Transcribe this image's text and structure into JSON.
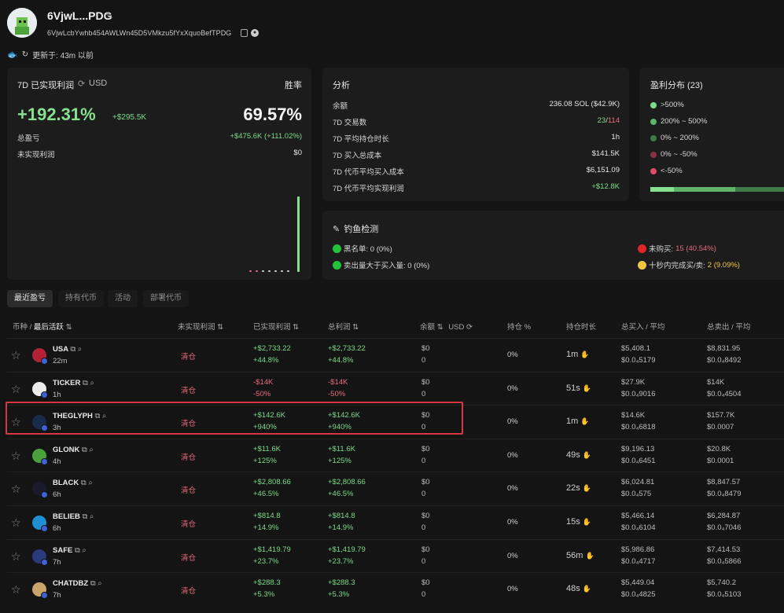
{
  "header": {
    "wallet_name": "6VjwL...PDG",
    "address": "6VjwLcbYwhb454AWLWn45D5VMkzu5fYxXquoBefTPDG",
    "updated": "更新于: 43m 以前"
  },
  "pnl_card": {
    "title": "7D 已实现利润",
    "currency": "USD",
    "winrate_label": "胜率",
    "pnl_pct": "+192.31%",
    "pnl_usd": "+$295.5K",
    "winrate": "69.57%",
    "total_label": "总盈亏",
    "total_value": "+$475.6K (+111.02%)",
    "unrealized_label": "未实现利润",
    "unrealized_value": "$0"
  },
  "analysis": {
    "title": "分析",
    "rows": [
      {
        "label": "余额",
        "value": "236.08 SOL ($42.9K)"
      },
      {
        "label": "7D 交易数",
        "value_a": "23",
        "sep": "/",
        "value_b": "114"
      },
      {
        "label": "7D 平均持仓时长",
        "value": "1h"
      },
      {
        "label": "7D 买入总成本",
        "value": "$141.5K"
      },
      {
        "label": "7D 代币平均买入成本",
        "value": "$6,151.09"
      },
      {
        "label": "7D 代币平均实现利润",
        "value": "+$12.8K"
      }
    ]
  },
  "distribution": {
    "title": "盈利分布 (23)",
    "items": [
      {
        "label": ">500%",
        "color": "#7ddc89"
      },
      {
        "label": "200% ~ 500%",
        "color": "#5db36a"
      },
      {
        "label": "0% ~ 200%",
        "color": "#3f7a49"
      },
      {
        "label": "0% ~ -50%",
        "color": "#8c2f44"
      },
      {
        "label": "<-50%",
        "color": "#e04a6a"
      }
    ]
  },
  "phishing": {
    "title": "钓鱼检测",
    "blacklist": "黑名单: 0 (0%)",
    "sell_gt_buy": "卖出量大于买入量: 0 (0%)",
    "not_bought_label": "未购买:",
    "not_bought_value": "15 (40.54%)",
    "fast_label": "十秒内完成买/卖:",
    "fast_value": "2 (9.09%)"
  },
  "tabs": [
    "最近盈亏",
    "持有代币",
    "活动",
    "部署代币"
  ],
  "table": {
    "headers": {
      "token": "币种 /",
      "token_sort": "最后活跃",
      "unrealized": "未实现利润",
      "realized": "已实现利润",
      "total": "总利润",
      "balance": "余额",
      "balance_unit": "USD",
      "holding": "持仓 %",
      "duration": "持仓时长",
      "buy": "总买入 / 平均",
      "sell": "总卖出 / 平均"
    },
    "rows": [
      {
        "sym": "USA",
        "age": "22m",
        "status": "清仓",
        "realized": "+$2,733.22",
        "realized_pct": "+44.8%",
        "total": "+$2,733.22",
        "total_pct": "+44.8%",
        "bal": "$0",
        "bal2": "0",
        "hold": "0%",
        "dur": "1m",
        "buy": "$5,408.1",
        "buy_avg": "$0.0₄5179",
        "sell": "$8,831.95",
        "sell_avg": "$0.0₄8492",
        "neg": false
      },
      {
        "sym": "TICKER",
        "age": "1h",
        "status": "清仓",
        "realized": "-$14K",
        "realized_pct": "-50%",
        "total": "-$14K",
        "total_pct": "-50%",
        "bal": "$0",
        "bal2": "0",
        "hold": "0%",
        "dur": "51s",
        "buy": "$27.9K",
        "buy_avg": "$0.0₄9016",
        "sell": "$14K",
        "sell_avg": "$0.0₄4504",
        "neg": true
      },
      {
        "sym": "THEGLYPH",
        "age": "3h",
        "status": "清仓",
        "realized": "+$142.6K",
        "realized_pct": "+940%",
        "total": "+$142.6K",
        "total_pct": "+940%",
        "bal": "$0",
        "bal2": "0",
        "hold": "0%",
        "dur": "1m",
        "buy": "$14.6K",
        "buy_avg": "$0.0₄6818",
        "sell": "$157.7K",
        "sell_avg": "$0.0007",
        "neg": false
      },
      {
        "sym": "GLONK",
        "age": "4h",
        "status": "清仓",
        "realized": "+$11.6K",
        "realized_pct": "+125%",
        "total": "+$11.6K",
        "total_pct": "+125%",
        "bal": "$0",
        "bal2": "0",
        "hold": "0%",
        "dur": "49s",
        "buy": "$9,196.13",
        "buy_avg": "$0.0₄6451",
        "sell": "$20.8K",
        "sell_avg": "$0.0001",
        "neg": false
      },
      {
        "sym": "BLACK",
        "age": "6h",
        "status": "清仓",
        "realized": "+$2,808.66",
        "realized_pct": "+46.5%",
        "total": "+$2,808.66",
        "total_pct": "+46.5%",
        "bal": "$0",
        "bal2": "0",
        "hold": "0%",
        "dur": "22s",
        "buy": "$6,024.81",
        "buy_avg": "$0.0₄575",
        "sell": "$8,847.57",
        "sell_avg": "$0.0₄8479",
        "neg": false
      },
      {
        "sym": "BELIEB",
        "age": "6h",
        "status": "清仓",
        "realized": "+$814.8",
        "realized_pct": "+14.9%",
        "total": "+$814.8",
        "total_pct": "+14.9%",
        "bal": "$0",
        "bal2": "0",
        "hold": "0%",
        "dur": "15s",
        "buy": "$5,466.14",
        "buy_avg": "$0.0₄6104",
        "sell": "$6,284.87",
        "sell_avg": "$0.0₄7046",
        "neg": false
      },
      {
        "sym": "SAFE",
        "age": "7h",
        "status": "清仓",
        "realized": "+$1,419.79",
        "realized_pct": "+23.7%",
        "total": "+$1,419.79",
        "total_pct": "+23.7%",
        "bal": "$0",
        "bal2": "0",
        "hold": "0%",
        "dur": "56m",
        "buy": "$5,986.86",
        "buy_avg": "$0.0₄4717",
        "sell": "$7,414.53",
        "sell_avg": "$0.0₄5866",
        "neg": false
      },
      {
        "sym": "CHATDBZ",
        "age": "7h",
        "status": "清仓",
        "realized": "+$288.3",
        "realized_pct": "+5.3%",
        "total": "+$288.3",
        "total_pct": "+5.3%",
        "bal": "$0",
        "bal2": "0",
        "hold": "0%",
        "dur": "48s",
        "buy": "$5,449.04",
        "buy_avg": "$0.0₄4825",
        "sell": "$5,740.2",
        "sell_avg": "$0.0₄5103",
        "neg": false
      }
    ]
  }
}
